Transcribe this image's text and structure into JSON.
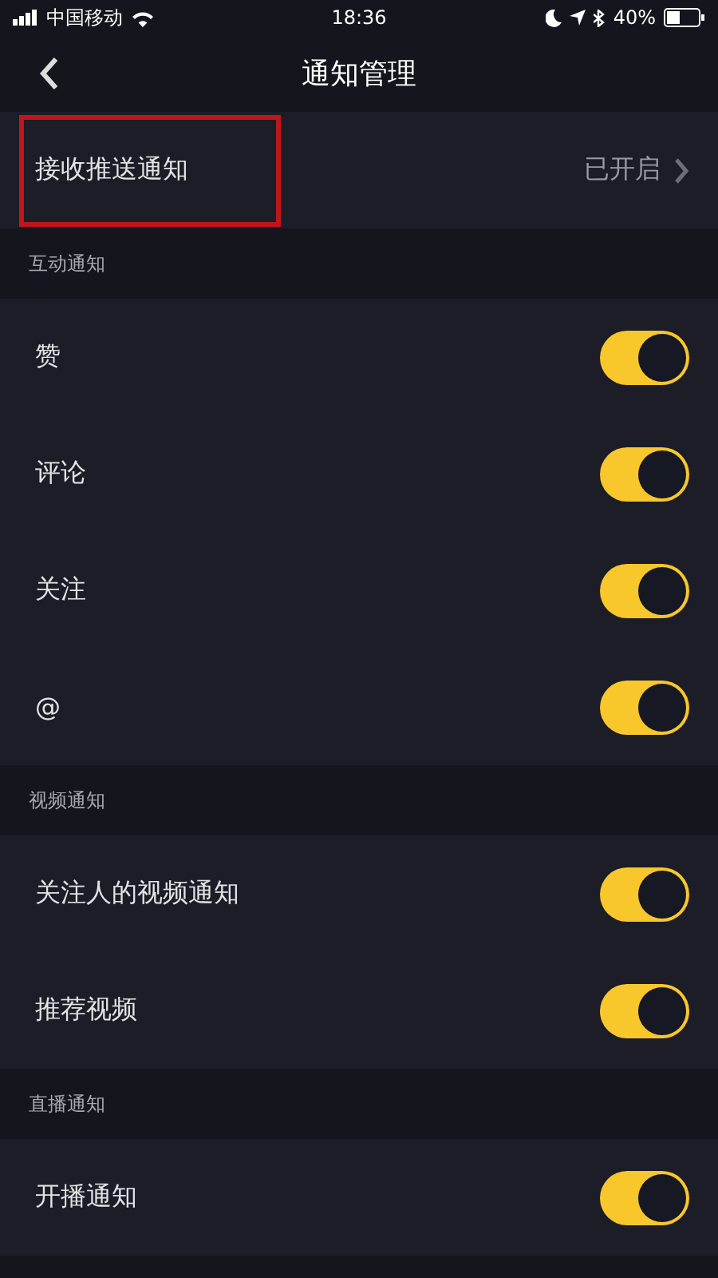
{
  "status_bar": {
    "carrier": "中国移动",
    "time": "18:36",
    "battery": "40%"
  },
  "nav": {
    "title": "通知管理"
  },
  "push_row": {
    "label": "接收推送通知",
    "value": "已开启",
    "highlighted": true
  },
  "sections": [
    {
      "title": "互动通知",
      "items": [
        {
          "label": "赞",
          "on": true
        },
        {
          "label": "评论",
          "on": true
        },
        {
          "label": "关注",
          "on": true
        },
        {
          "label": "@",
          "on": true
        }
      ]
    },
    {
      "title": "视频通知",
      "items": [
        {
          "label": "关注人的视频通知",
          "on": true
        },
        {
          "label": "推荐视频",
          "on": true
        }
      ]
    },
    {
      "title": "直播通知",
      "items": [
        {
          "label": "开播通知",
          "on": true
        }
      ]
    }
  ]
}
